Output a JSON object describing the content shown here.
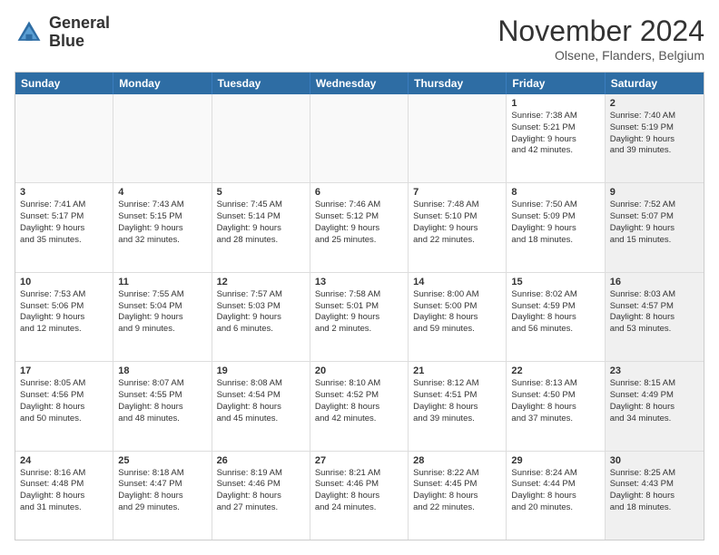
{
  "logo": {
    "line1": "General",
    "line2": "Blue"
  },
  "title": "November 2024",
  "location": "Olsene, Flanders, Belgium",
  "weekdays": [
    "Sunday",
    "Monday",
    "Tuesday",
    "Wednesday",
    "Thursday",
    "Friday",
    "Saturday"
  ],
  "rows": [
    [
      {
        "day": "",
        "lines": [],
        "shaded": false
      },
      {
        "day": "",
        "lines": [],
        "shaded": false
      },
      {
        "day": "",
        "lines": [],
        "shaded": false
      },
      {
        "day": "",
        "lines": [],
        "shaded": false
      },
      {
        "day": "",
        "lines": [],
        "shaded": false
      },
      {
        "day": "1",
        "lines": [
          "Sunrise: 7:38 AM",
          "Sunset: 5:21 PM",
          "Daylight: 9 hours",
          "and 42 minutes."
        ],
        "shaded": false
      },
      {
        "day": "2",
        "lines": [
          "Sunrise: 7:40 AM",
          "Sunset: 5:19 PM",
          "Daylight: 9 hours",
          "and 39 minutes."
        ],
        "shaded": true
      }
    ],
    [
      {
        "day": "3",
        "lines": [
          "Sunrise: 7:41 AM",
          "Sunset: 5:17 PM",
          "Daylight: 9 hours",
          "and 35 minutes."
        ],
        "shaded": false
      },
      {
        "day": "4",
        "lines": [
          "Sunrise: 7:43 AM",
          "Sunset: 5:15 PM",
          "Daylight: 9 hours",
          "and 32 minutes."
        ],
        "shaded": false
      },
      {
        "day": "5",
        "lines": [
          "Sunrise: 7:45 AM",
          "Sunset: 5:14 PM",
          "Daylight: 9 hours",
          "and 28 minutes."
        ],
        "shaded": false
      },
      {
        "day": "6",
        "lines": [
          "Sunrise: 7:46 AM",
          "Sunset: 5:12 PM",
          "Daylight: 9 hours",
          "and 25 minutes."
        ],
        "shaded": false
      },
      {
        "day": "7",
        "lines": [
          "Sunrise: 7:48 AM",
          "Sunset: 5:10 PM",
          "Daylight: 9 hours",
          "and 22 minutes."
        ],
        "shaded": false
      },
      {
        "day": "8",
        "lines": [
          "Sunrise: 7:50 AM",
          "Sunset: 5:09 PM",
          "Daylight: 9 hours",
          "and 18 minutes."
        ],
        "shaded": false
      },
      {
        "day": "9",
        "lines": [
          "Sunrise: 7:52 AM",
          "Sunset: 5:07 PM",
          "Daylight: 9 hours",
          "and 15 minutes."
        ],
        "shaded": true
      }
    ],
    [
      {
        "day": "10",
        "lines": [
          "Sunrise: 7:53 AM",
          "Sunset: 5:06 PM",
          "Daylight: 9 hours",
          "and 12 minutes."
        ],
        "shaded": false
      },
      {
        "day": "11",
        "lines": [
          "Sunrise: 7:55 AM",
          "Sunset: 5:04 PM",
          "Daylight: 9 hours",
          "and 9 minutes."
        ],
        "shaded": false
      },
      {
        "day": "12",
        "lines": [
          "Sunrise: 7:57 AM",
          "Sunset: 5:03 PM",
          "Daylight: 9 hours",
          "and 6 minutes."
        ],
        "shaded": false
      },
      {
        "day": "13",
        "lines": [
          "Sunrise: 7:58 AM",
          "Sunset: 5:01 PM",
          "Daylight: 9 hours",
          "and 2 minutes."
        ],
        "shaded": false
      },
      {
        "day": "14",
        "lines": [
          "Sunrise: 8:00 AM",
          "Sunset: 5:00 PM",
          "Daylight: 8 hours",
          "and 59 minutes."
        ],
        "shaded": false
      },
      {
        "day": "15",
        "lines": [
          "Sunrise: 8:02 AM",
          "Sunset: 4:59 PM",
          "Daylight: 8 hours",
          "and 56 minutes."
        ],
        "shaded": false
      },
      {
        "day": "16",
        "lines": [
          "Sunrise: 8:03 AM",
          "Sunset: 4:57 PM",
          "Daylight: 8 hours",
          "and 53 minutes."
        ],
        "shaded": true
      }
    ],
    [
      {
        "day": "17",
        "lines": [
          "Sunrise: 8:05 AM",
          "Sunset: 4:56 PM",
          "Daylight: 8 hours",
          "and 50 minutes."
        ],
        "shaded": false
      },
      {
        "day": "18",
        "lines": [
          "Sunrise: 8:07 AM",
          "Sunset: 4:55 PM",
          "Daylight: 8 hours",
          "and 48 minutes."
        ],
        "shaded": false
      },
      {
        "day": "19",
        "lines": [
          "Sunrise: 8:08 AM",
          "Sunset: 4:54 PM",
          "Daylight: 8 hours",
          "and 45 minutes."
        ],
        "shaded": false
      },
      {
        "day": "20",
        "lines": [
          "Sunrise: 8:10 AM",
          "Sunset: 4:52 PM",
          "Daylight: 8 hours",
          "and 42 minutes."
        ],
        "shaded": false
      },
      {
        "day": "21",
        "lines": [
          "Sunrise: 8:12 AM",
          "Sunset: 4:51 PM",
          "Daylight: 8 hours",
          "and 39 minutes."
        ],
        "shaded": false
      },
      {
        "day": "22",
        "lines": [
          "Sunrise: 8:13 AM",
          "Sunset: 4:50 PM",
          "Daylight: 8 hours",
          "and 37 minutes."
        ],
        "shaded": false
      },
      {
        "day": "23",
        "lines": [
          "Sunrise: 8:15 AM",
          "Sunset: 4:49 PM",
          "Daylight: 8 hours",
          "and 34 minutes."
        ],
        "shaded": true
      }
    ],
    [
      {
        "day": "24",
        "lines": [
          "Sunrise: 8:16 AM",
          "Sunset: 4:48 PM",
          "Daylight: 8 hours",
          "and 31 minutes."
        ],
        "shaded": false
      },
      {
        "day": "25",
        "lines": [
          "Sunrise: 8:18 AM",
          "Sunset: 4:47 PM",
          "Daylight: 8 hours",
          "and 29 minutes."
        ],
        "shaded": false
      },
      {
        "day": "26",
        "lines": [
          "Sunrise: 8:19 AM",
          "Sunset: 4:46 PM",
          "Daylight: 8 hours",
          "and 27 minutes."
        ],
        "shaded": false
      },
      {
        "day": "27",
        "lines": [
          "Sunrise: 8:21 AM",
          "Sunset: 4:46 PM",
          "Daylight: 8 hours",
          "and 24 minutes."
        ],
        "shaded": false
      },
      {
        "day": "28",
        "lines": [
          "Sunrise: 8:22 AM",
          "Sunset: 4:45 PM",
          "Daylight: 8 hours",
          "and 22 minutes."
        ],
        "shaded": false
      },
      {
        "day": "29",
        "lines": [
          "Sunrise: 8:24 AM",
          "Sunset: 4:44 PM",
          "Daylight: 8 hours",
          "and 20 minutes."
        ],
        "shaded": false
      },
      {
        "day": "30",
        "lines": [
          "Sunrise: 8:25 AM",
          "Sunset: 4:43 PM",
          "Daylight: 8 hours",
          "and 18 minutes."
        ],
        "shaded": true
      }
    ]
  ]
}
